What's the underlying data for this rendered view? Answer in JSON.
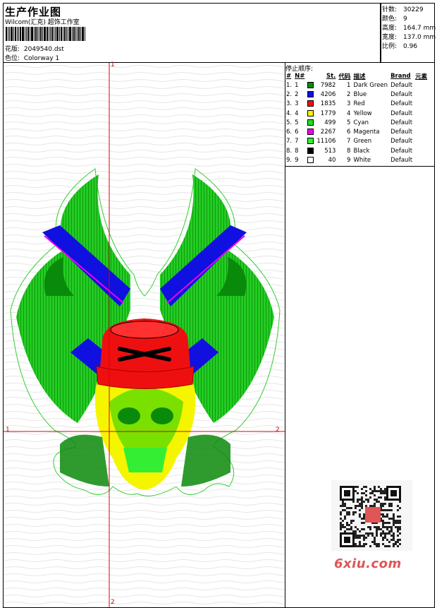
{
  "header": {
    "title": "生产作业图",
    "studio": "Wilcom(汇克) 超饰工作室",
    "design_label": "花版:",
    "design_value": "2049540.dst",
    "colorway_label": "色位:",
    "colorway_value": "Colorway 1"
  },
  "stats": [
    {
      "label": "针数:",
      "value": "30229"
    },
    {
      "label": "颜色:",
      "value": "9"
    },
    {
      "label": "高度:",
      "value": "164.7 mm"
    },
    {
      "label": "宽度:",
      "value": "137.0 mm"
    },
    {
      "label": "比例:",
      "value": "0.96"
    }
  ],
  "legend": {
    "title": "停止顺序:",
    "columns": [
      "#",
      "N#",
      "St.",
      "代码",
      "描述",
      "Brand",
      "元素"
    ],
    "rows": [
      {
        "idx": "1.",
        "n": "1",
        "color": "#0a8a0a",
        "st": "7982",
        "code": "1",
        "desc": "Dark Green",
        "brand": "Default"
      },
      {
        "idx": "2.",
        "n": "2",
        "color": "#1010e0",
        "st": "4206",
        "code": "2",
        "desc": "Blue",
        "brand": "Default"
      },
      {
        "idx": "3.",
        "n": "3",
        "color": "#ee1010",
        "st": "1835",
        "code": "3",
        "desc": "Red",
        "brand": "Default"
      },
      {
        "idx": "4.",
        "n": "4",
        "color": "#f5f500",
        "st": "1779",
        "code": "4",
        "desc": "Yellow",
        "brand": "Default"
      },
      {
        "idx": "5.",
        "n": "5",
        "color": "#22dd22",
        "st": "499",
        "code": "5",
        "desc": "Cyan",
        "brand": "Default"
      },
      {
        "idx": "6.",
        "n": "6",
        "color": "#ee00ee",
        "st": "2267",
        "code": "6",
        "desc": "Magenta",
        "brand": "Default"
      },
      {
        "idx": "7.",
        "n": "7",
        "color": "#33ee33",
        "st": "11106",
        "code": "7",
        "desc": "Green",
        "brand": "Default"
      },
      {
        "idx": "8.",
        "n": "8",
        "color": "#000000",
        "st": "513",
        "code": "8",
        "desc": "Black",
        "brand": "Default"
      },
      {
        "idx": "9.",
        "n": "9",
        "color": "#ffffff",
        "st": "40",
        "code": "9",
        "desc": "White",
        "brand": "Default"
      }
    ]
  },
  "axes": {
    "v_top": "1",
    "v_bottom": "2",
    "h_left": "1",
    "h_right": "2",
    "color": "#e00000"
  },
  "watermark": "6xiu.com"
}
